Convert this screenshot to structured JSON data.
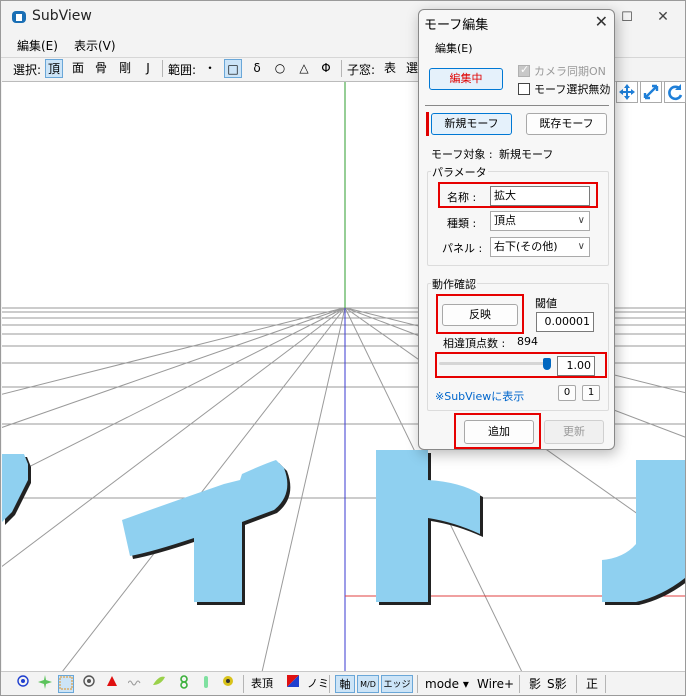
{
  "app": {
    "title": "SubView",
    "controls": {
      "minimize": "—",
      "maximize": "☐",
      "close": "✕"
    }
  },
  "menubar": [
    {
      "label": "編集(E)"
    },
    {
      "label": "表示(V)"
    }
  ],
  "toolbar": {
    "select_label": "選択:",
    "select_items": [
      "頂",
      "面",
      "骨",
      "剛",
      "J"
    ],
    "range_label": "範囲:",
    "range_items": [
      "・",
      "□",
      "δ",
      "○",
      "△",
      "Φ"
    ],
    "child_label": "子窓:",
    "child_items": [
      "表",
      "選"
    ]
  },
  "viewport": {
    "title_text_color": "#8fd0f0",
    "grid_color": "#9a9a9a",
    "axis_green": "#2e9e2e",
    "axis_red": "#e04040",
    "axis_blue": "#3a3ad0"
  },
  "bottombar": {
    "items": [
      "表頂",
      "ノミ",
      "軸",
      "M/D",
      "エッジ",
      "mode ▾",
      "Wire+",
      "影",
      "S影",
      "正"
    ]
  },
  "dialog": {
    "title": "モーフ編集",
    "menu": "編集(E)",
    "editing_button": "編集中",
    "camera_sync": "カメラ同期ON",
    "camera_sync_checked": true,
    "morph_select_disable": "モーフ選択無効",
    "morph_select_disable_checked": false,
    "new_morph_tab": "新規モーフ",
    "existing_morph_tab": "既存モーフ",
    "morph_target_label": "モーフ対象 :",
    "morph_target_value": "新規モーフ",
    "params_group": "パラメータ",
    "name_label": "名称 :",
    "name_value": "拡大",
    "type_label": "種類 :",
    "type_value": "頂点",
    "panel_label": "パネル :",
    "panel_value": "右下(その他)",
    "check_group": "動作確認",
    "apply_button": "反映",
    "threshold_label": "閾値",
    "threshold_value": "0.00001",
    "diff_label": "相違頂点数 :",
    "diff_value": "894",
    "slider_value": "1.00",
    "slider_fraction": 1.0,
    "subview_note": "※SubViewに表示",
    "btn_zero": "0",
    "btn_one": "1",
    "add_button": "追加",
    "update_button": "更新"
  }
}
